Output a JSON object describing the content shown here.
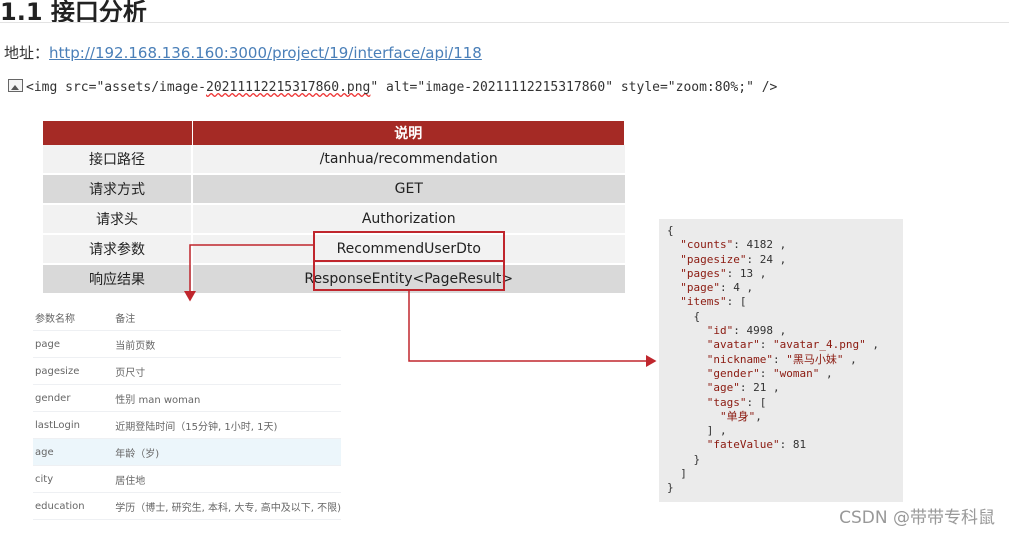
{
  "heading": "1.1 接口分析",
  "address": {
    "label": "地址：",
    "url": "http://192.168.136.160:3000/project/19/interface/api/118"
  },
  "img_tag": {
    "before": "<img src=\"assets/image-",
    "underlined": "20211112215317860.png",
    "after": "\" alt=\"image-20211112215317860\" style=\"zoom:80%;\" />",
    "icon": "broken-image-icon"
  },
  "spec_table": {
    "header": [
      "",
      "说明"
    ],
    "rows": [
      [
        "接口路径",
        "/tanhua/recommendation"
      ],
      [
        "请求方式",
        "GET"
      ],
      [
        "请求头",
        "Authorization"
      ],
      [
        "请求参数",
        "RecommendUserDto"
      ],
      [
        "响应结果",
        "ResponseEntity<PageResult>"
      ]
    ]
  },
  "params_table": {
    "rows": [
      [
        "参数名称",
        "备注"
      ],
      [
        "page",
        "当前页数"
      ],
      [
        "pagesize",
        "页尺寸"
      ],
      [
        "gender",
        "性别 man woman"
      ],
      [
        "lastLogin",
        "近期登陆时间（15分钟, 1小时, 1天)"
      ],
      [
        "age",
        "年龄（岁)"
      ],
      [
        "city",
        "居住地"
      ],
      [
        "education",
        "学历（博士, 研究生, 本科, 大专, 高中及以下, 不限)"
      ]
    ]
  },
  "json_lines": [
    "{",
    "  \"counts\": 4182 ,",
    "  \"pagesize\": 24 ,",
    "  \"pages\": 13 ,",
    "  \"page\": 4 ,",
    "  \"items\": [",
    "    {",
    "      \"id\": 4998 ,",
    "      \"avatar\": \"avatar_4.png\" ,",
    "      \"nickname\": \"黑马小妹\" ,",
    "      \"gender\": \"woman\" ,",
    "      \"age\": 21 ,",
    "      \"tags\": [",
    "        \"单身\",",
    "      ] ,",
    "      \"fateValue\": 81",
    "    }",
    "  ]",
    "}"
  ],
  "watermark": "CSDN @带带专科鼠",
  "colors": {
    "header_red": "#a52a25",
    "box_red": "#c0262d",
    "link": "#4a7fb8"
  }
}
